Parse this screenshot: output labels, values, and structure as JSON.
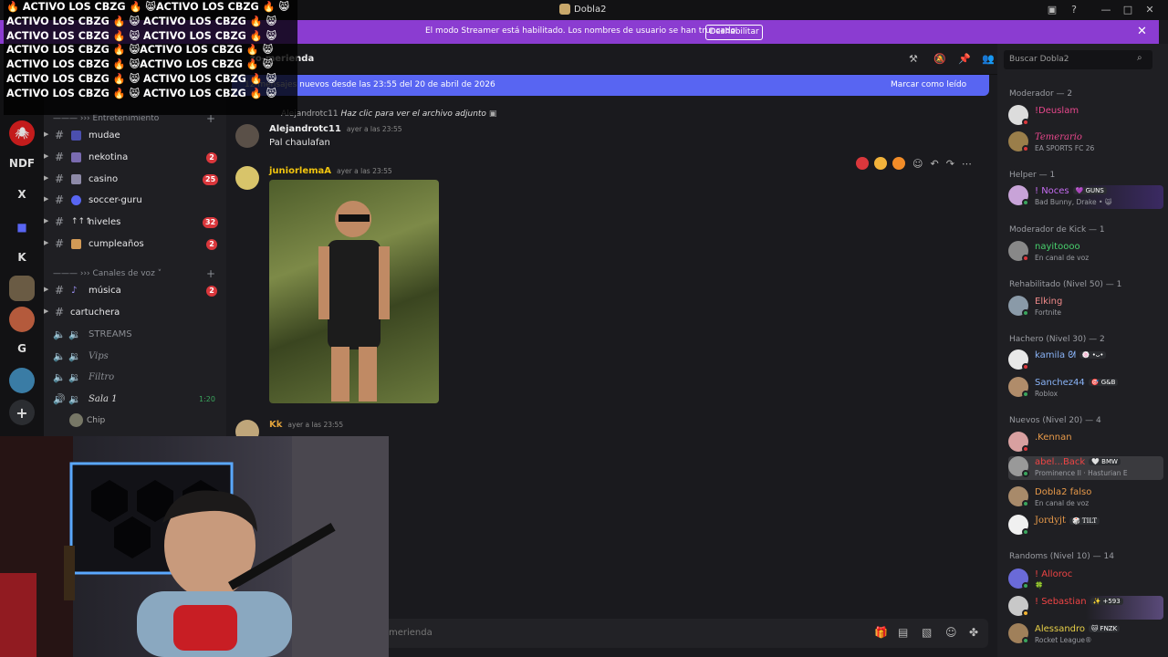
{
  "window": {
    "title": "Dobla2"
  },
  "banner": {
    "message": "El modo Streamer está habilitado. Los nombres de usuario se han truncado.",
    "button": "Deshabilitar"
  },
  "overlay_text": "🔥 ACTIVO LOS CBZG 🔥 😸ACTIVO LOS CBZG 🔥 😸 ACTIVO LOS CBZG 🔥 😸 ACTIVO LOS CBZG 🔥 😸 ACTIVO LOS CBZG 🔥 😸 ACTIVO LOS CBZG 🔥 😸 ACTIVO LOS CBZG 🔥 😸ACTIVO LOS CBZG 🔥 😸 ACTIVO LOS CBZG 🔥 😸ACTIVO LOS CBZG 🔥 😸 ACTIVO LOS CBZG 🔥 😸 ACTIVO LOS CBZG 🔥 😸 ACTIVO LOS CBZG 🔥 😸 ACTIVO LOS CBZG 🔥 😸",
  "rail": {
    "items": [
      "NDF",
      "X",
      "K",
      "G"
    ]
  },
  "sidebar": {
    "category_entertainment": "——— ››› Entretenimiento",
    "category_voice": "——— ››› Canales de voz ˅",
    "channels": [
      {
        "name": "mudae",
        "badge": ""
      },
      {
        "name": "nekotina",
        "badge": "2"
      },
      {
        "name": "casino",
        "badge": "25"
      },
      {
        "name": "soccer-guru",
        "badge": ""
      },
      {
        "name": "niveles",
        "badge": "32"
      },
      {
        "name": "cumpleaños",
        "badge": "2"
      },
      {
        "name": "música",
        "badge": "2"
      },
      {
        "name": "cartuchera",
        "badge": ""
      }
    ],
    "voice": [
      {
        "name": "STREAMS",
        "time": ""
      },
      {
        "name": "Vips",
        "time": ""
      },
      {
        "name": "Filtro",
        "time": ""
      },
      {
        "name": "Sala 1",
        "time": "1:20"
      }
    ],
    "voice_user": "Chip"
  },
  "chat": {
    "channel_name": "zo-merienda",
    "new_messages_text": "12 mensajes nuevos desde las 23:55 del 20 de abril de 2026",
    "mark_read": "Marcar como leído",
    "reply_author": "Alejandrotc11",
    "reply_text": "Haz clic para ver el archivo adjunto",
    "messages": [
      {
        "author": "Alejandrotc11",
        "time": "ayer a las 23:55",
        "text": "Pal chaulafan"
      },
      {
        "author": "juniorlemaA",
        "time": "ayer a las 23:55",
        "text": ""
      },
      {
        "author": "Kk",
        "time": "ayer a las 23:55",
        "text": ""
      }
    ],
    "composer_placeholder": "merienda"
  },
  "members": {
    "search_placeholder": "Buscar Dobla2",
    "groups": [
      {
        "title": "Moderador — 2",
        "members": [
          {
            "name": "!Deuslam",
            "sub": "",
            "tag": "",
            "color": "#e8478c"
          },
          {
            "name": "Temerario",
            "sub": "EA SPORTS FC 26",
            "tag": "",
            "color": "#e8478c"
          }
        ]
      },
      {
        "title": "Helper — 1",
        "members": [
          {
            "name": "! Noces",
            "sub": "Bad Bunny, Drake • 😸",
            "tag": "💜 GUNS",
            "color": "#c46cf0"
          }
        ]
      },
      {
        "title": "Moderador de Kick — 1",
        "members": [
          {
            "name": "nayitoooo",
            "sub": "En canal de voz",
            "tag": "",
            "color": "#48d16d"
          }
        ]
      },
      {
        "title": "Rehabilitado (Nivel 50) — 1",
        "members": [
          {
            "name": "Elking",
            "sub": "Fortnite",
            "tag": "",
            "color": "#f08a8a"
          }
        ]
      },
      {
        "title": "Hachero (Nivel 30) — 2",
        "members": [
          {
            "name": "kamila ᘛ",
            "sub": "",
            "tag": "🍥 •ᴗ•",
            "color": "#8ab4f8"
          },
          {
            "name": "Sanchez44",
            "sub": "Roblox",
            "tag": "🎯 G&B",
            "color": "#8ab4f8"
          }
        ]
      },
      {
        "title": "Nuevos (Nivel 20) — 4",
        "members": [
          {
            "name": ".Kennan",
            "sub": "",
            "tag": "",
            "color": "#e89a4a"
          },
          {
            "name": "abel...Back",
            "sub": "Prominence II · Hasturian E",
            "tag": "🤍 BMW",
            "color": "#ee4444"
          },
          {
            "name": "Dobla2 falso",
            "sub": "En canal de voz",
            "tag": "",
            "color": "#e89a4a"
          },
          {
            "name": "Jordyjt",
            "sub": "",
            "tag": "🎲 TILT",
            "color": "#e89a4a"
          }
        ]
      },
      {
        "title": "Randoms (Nivel 10) — 14",
        "members": [
          {
            "name": "! Alloroc",
            "sub": "🍀",
            "tag": "",
            "color": "#ee4444"
          },
          {
            "name": "! Sebastian",
            "sub": "",
            "tag": "✨ +593",
            "color": "#ee4444"
          },
          {
            "name": "Alessandro",
            "sub": "Rocket League®",
            "tag": "🐱 FNZK",
            "color": "#e8d048"
          }
        ]
      }
    ]
  }
}
